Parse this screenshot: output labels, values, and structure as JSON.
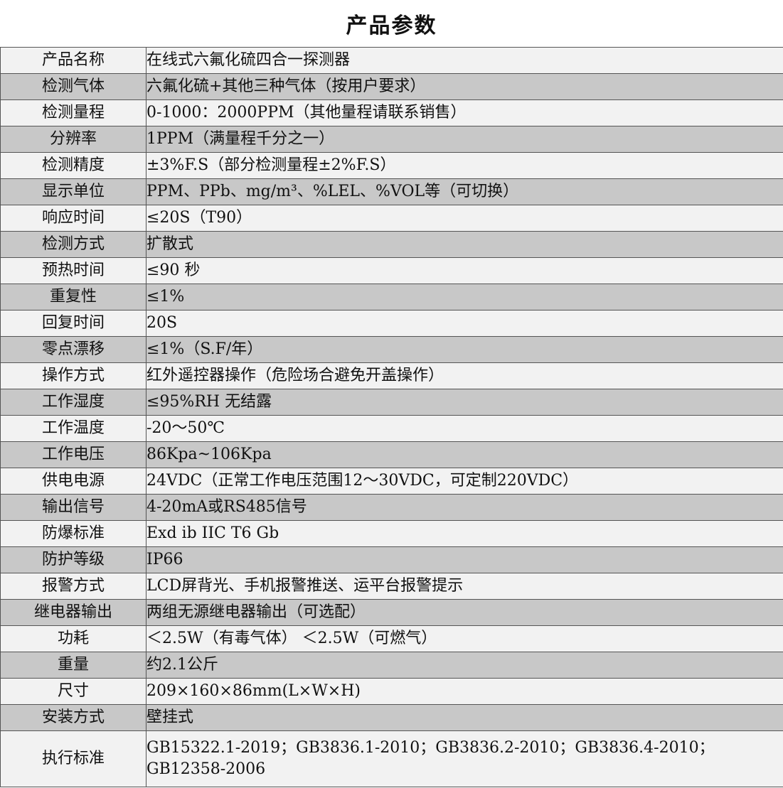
{
  "title": "产品参数",
  "rows": [
    {
      "key": "产品名称",
      "value": "在线式六氟化硫四合一探测器"
    },
    {
      "key": "检测气体",
      "value": "六氟化硫+其他三种气体（按用户要求）"
    },
    {
      "key": "检测量程",
      "value": "0-1000：2000PPM（其他量程请联系销售）"
    },
    {
      "key": "分辨率",
      "value": "1PPM（满量程千分之一）"
    },
    {
      "key": "检测精度",
      "value": "±3%F.S（部分检测量程±2%F.S）"
    },
    {
      "key": "显示单位",
      "value": "PPM、PPb、mg/m³、%LEL、%VOL等（可切换）"
    },
    {
      "key": "响应时间",
      "value": "≤20S（T90）"
    },
    {
      "key": "检测方式",
      "value": "扩散式"
    },
    {
      "key": "预热时间",
      "value": "≤90 秒"
    },
    {
      "key": "重复性",
      "value": "≤1%"
    },
    {
      "key": "回复时间",
      "value": "20S"
    },
    {
      "key": "零点漂移",
      "value": "≤1%（S.F/年）"
    },
    {
      "key": "操作方式",
      "value": "红外遥控器操作（危险场合避免开盖操作）"
    },
    {
      "key": "工作湿度",
      "value": "≤95%RH 无结露"
    },
    {
      "key": "工作温度",
      "value": " -20～50℃"
    },
    {
      "key": "工作电压",
      "value": "86Kpa~106Kpa"
    },
    {
      "key": "供电电源",
      "value": "24VDC（正常工作电压范围12～30VDC，可定制220VDC）"
    },
    {
      "key": "输出信号",
      "value": "4-20mA或RS485信号"
    },
    {
      "key": "防爆标准",
      "value": "Exd ib IIC T6 Gb"
    },
    {
      "key": "防护等级",
      "value": "IP66"
    },
    {
      "key": "报警方式",
      "value": "LCD屏背光、手机报警推送、运平台报警提示"
    },
    {
      "key": "继电器输出",
      "value": "两组无源继电器输出（可选配）"
    },
    {
      "key": "功耗",
      "value": "＜2.5W（有毒气体）  ＜2.5W（可燃气）"
    },
    {
      "key": "重量",
      "value": "约2.1公斤"
    },
    {
      "key": "尺寸",
      "value": "209×160×86mm(L×W×H)"
    },
    {
      "key": "安装方式",
      "value": "壁挂式"
    },
    {
      "key": "执行标准",
      "value": "GB15322.1-2019；GB3836.1-2010；GB3836.2-2010；GB3836.4-2010；GB12358-2006"
    }
  ]
}
